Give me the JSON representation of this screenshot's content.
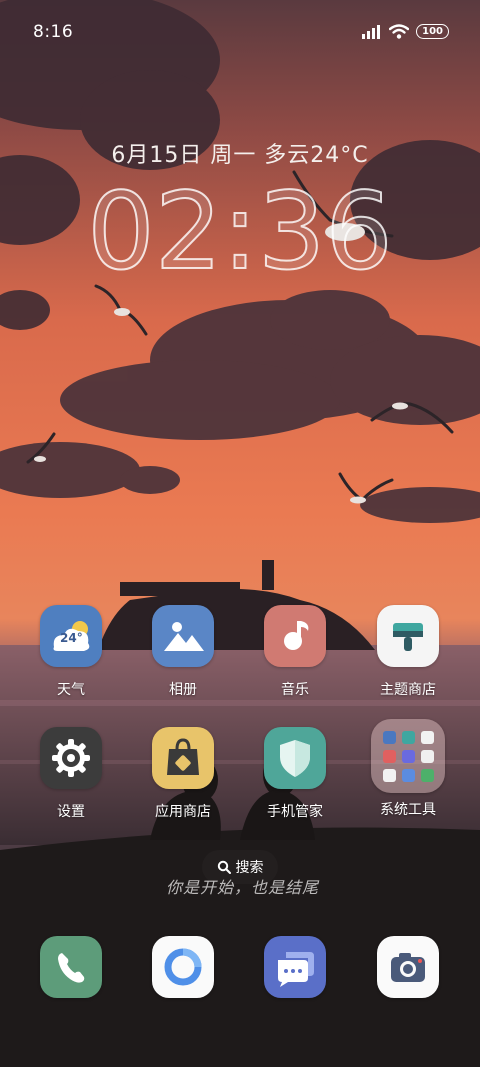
{
  "status_bar": {
    "time": "8:16",
    "battery": "100",
    "icons": [
      "signal-icon",
      "wifi-icon",
      "battery-icon"
    ]
  },
  "lockscreen": {
    "date": "6月15日 周一 多云24°C",
    "clock": "02:36"
  },
  "apps": [
    {
      "label": "天气",
      "icon": "weather-icon",
      "badge_text": "24°"
    },
    {
      "label": "相册",
      "icon": "gallery-icon"
    },
    {
      "label": "音乐",
      "icon": "music-icon"
    },
    {
      "label": "主题商店",
      "icon": "theme-store-icon"
    },
    {
      "label": "设置",
      "icon": "settings-icon"
    },
    {
      "label": "应用商店",
      "icon": "app-store-icon"
    },
    {
      "label": "手机管家",
      "icon": "phone-manager-icon"
    },
    {
      "label": "系统工具",
      "icon": "system-tools-folder-icon"
    }
  ],
  "search": {
    "label": "搜索",
    "icon": "search-icon"
  },
  "wallpaper_text": "你是开始，也是结尾",
  "dock": [
    {
      "icon": "phone-icon"
    },
    {
      "icon": "browser-icon"
    },
    {
      "icon": "messages-icon"
    },
    {
      "icon": "camera-icon"
    }
  ],
  "colors": {
    "weather": "#4f7fc0",
    "gallery": "#5a86c6",
    "music": "#d07a72",
    "theme": "#f5f5f5",
    "settings": "#3c3c3c",
    "app_store": "#e8c46a",
    "phone_manager": "#4fa699",
    "phone": "#5d9c7a",
    "messages": "#5a6fc8"
  }
}
